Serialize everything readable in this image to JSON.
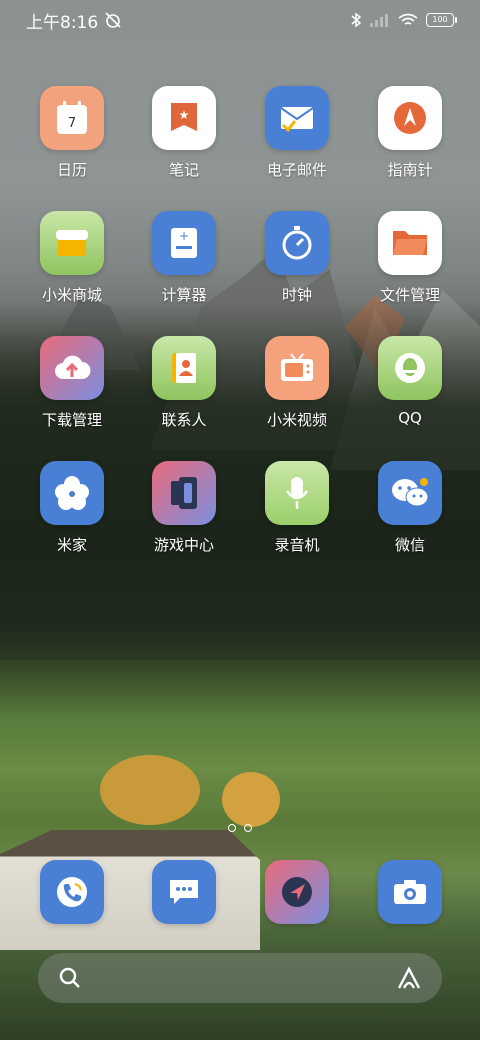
{
  "status": {
    "time": "上午8:16",
    "battery": "100"
  },
  "apps": [
    {
      "id": "calendar",
      "label": "日历",
      "glyph": "7",
      "bg": "#f2a37d"
    },
    {
      "id": "notes",
      "label": "笔记",
      "glyph": "★",
      "bg": "#ffffff"
    },
    {
      "id": "email",
      "label": "电子邮件",
      "glyph": "✉",
      "bg": "#4a7fd6"
    },
    {
      "id": "compass",
      "label": "指南针",
      "glyph": "",
      "bg": "#ffffff"
    },
    {
      "id": "mall",
      "label": "小米商城",
      "glyph": "",
      "bg": "#8fc45e"
    },
    {
      "id": "calculator",
      "label": "计算器",
      "glyph": "+",
      "bg": "#4a7fd6"
    },
    {
      "id": "clock",
      "label": "时钟",
      "glyph": "⏱",
      "bg": "#4a7fd6"
    },
    {
      "id": "files",
      "label": "文件管理",
      "glyph": "",
      "bg": "#ffffff"
    },
    {
      "id": "downloads",
      "label": "下载管理",
      "glyph": "",
      "bg": "#e96a7a"
    },
    {
      "id": "contacts",
      "label": "联系人",
      "glyph": "",
      "bg": "#8fc45e"
    },
    {
      "id": "video",
      "label": "小米视频",
      "glyph": "",
      "bg": "#f5a27c"
    },
    {
      "id": "qq",
      "label": "QQ",
      "glyph": "",
      "bg": "#8fc45e"
    },
    {
      "id": "mihome",
      "label": "米家",
      "glyph": "✿",
      "bg": "#4a7fd6"
    },
    {
      "id": "gamecenter",
      "label": "游戏中心",
      "glyph": "",
      "bg": "#e96a7a"
    },
    {
      "id": "recorder",
      "label": "录音机",
      "glyph": "🎙",
      "bg": "#9bcf6a"
    },
    {
      "id": "wechat",
      "label": "微信",
      "glyph": "",
      "bg": "#4a7fd6"
    }
  ],
  "dock": [
    {
      "id": "phone",
      "bg": "#4a7fd6"
    },
    {
      "id": "messages",
      "bg": "#4a7fd6"
    },
    {
      "id": "browser",
      "bg": "#e96a7a"
    },
    {
      "id": "camera",
      "bg": "#4a7fd6"
    }
  ],
  "colors": {
    "blue": "#4a7fd6",
    "green": "#8fc45e",
    "pink": "#e96a7a",
    "peach": "#f2a37d",
    "white": "#ffffff"
  }
}
